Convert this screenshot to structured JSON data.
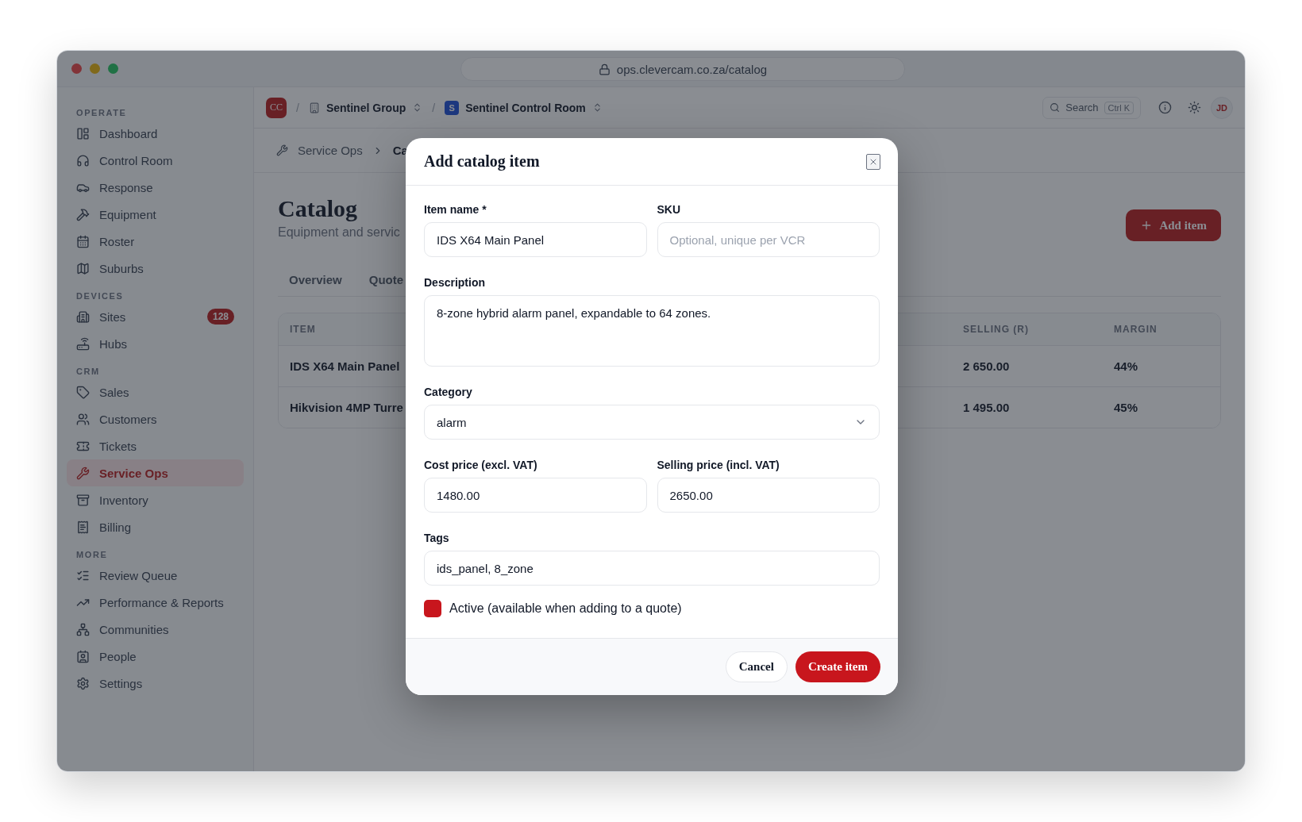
{
  "window": {
    "url": "ops.clevercam.co.za/catalog"
  },
  "sidebar": {
    "sections": [
      {
        "title": "OPERATE",
        "items": [
          {
            "label": "Dashboard",
            "selected": false
          },
          {
            "label": "Control Room",
            "selected": false
          },
          {
            "label": "Response",
            "selected": false
          },
          {
            "label": "Equipment",
            "selected": false
          },
          {
            "label": "Roster",
            "selected": false
          },
          {
            "label": "Suburbs",
            "selected": false
          }
        ]
      },
      {
        "title": "DEVICES",
        "items": [
          {
            "label": "Sites",
            "selected": false,
            "badge": "128"
          },
          {
            "label": "Hubs",
            "selected": false
          }
        ]
      },
      {
        "title": "CRM",
        "items": [
          {
            "label": "Sales",
            "selected": false
          },
          {
            "label": "Customers",
            "selected": false
          },
          {
            "label": "Tickets",
            "selected": false
          },
          {
            "label": "Service Ops",
            "selected": true
          },
          {
            "label": "Inventory",
            "selected": false
          },
          {
            "label": "Billing",
            "selected": false
          }
        ]
      },
      {
        "title": "MORE",
        "items": [
          {
            "label": "Review Queue",
            "selected": false
          },
          {
            "label": "Performance & Reports",
            "selected": false
          },
          {
            "label": "Communities",
            "selected": false
          },
          {
            "label": "People",
            "selected": false
          },
          {
            "label": "Settings",
            "selected": false
          }
        ]
      }
    ]
  },
  "topbar": {
    "org_logo": "CC",
    "separators": [
      "/",
      "/"
    ],
    "group": "Sentinel Group",
    "room_badge": "S",
    "room": "Sentinel Control Room",
    "search": "Search",
    "shortcut": "Ctrl K",
    "avatar": "JD"
  },
  "breadcrumb": [
    "Service Ops",
    "Ca"
  ],
  "page": {
    "title": "Catalog",
    "subtitle": "Equipment and servic",
    "add_button": "Add item",
    "tabs": [
      {
        "label": "Overview",
        "selected": false
      },
      {
        "label": "Quote",
        "selected": false
      }
    ],
    "table": {
      "columns": [
        "ITEM",
        "SELLING (R)",
        "MARGIN"
      ],
      "rows": [
        [
          "IDS X64 Main Panel",
          "2 650.00",
          "44%"
        ],
        [
          "Hikvision 4MP Turre",
          "1 495.00",
          "45%"
        ]
      ]
    }
  },
  "dialog": {
    "title": "Add catalog item",
    "rows": [
      [
        {
          "label": "Item name *",
          "kind": "text",
          "value": "IDS X64 Main Panel"
        },
        {
          "label": "SKU",
          "kind": "text",
          "placeholder": "Optional, unique per VCR"
        }
      ],
      [
        {
          "label": "Description",
          "kind": "textarea",
          "value": "8-zone hybrid alarm panel, expandable to 64 zones."
        }
      ],
      [
        {
          "label": "Category",
          "kind": "select",
          "value": "alarm"
        }
      ],
      [
        {
          "label": "Cost price (excl. VAT)",
          "kind": "text",
          "value": "1480.00"
        },
        {
          "label": "Selling price (incl. VAT)",
          "kind": "text",
          "value": "2650.00"
        }
      ],
      [
        {
          "label": "Tags",
          "kind": "text",
          "value": "ids_panel, 8_zone"
        }
      ]
    ],
    "active": {
      "label": "Active (available when adding to a quote)",
      "checked": true
    },
    "buttons": {
      "cancel": "Cancel",
      "create": "Create item"
    }
  }
}
